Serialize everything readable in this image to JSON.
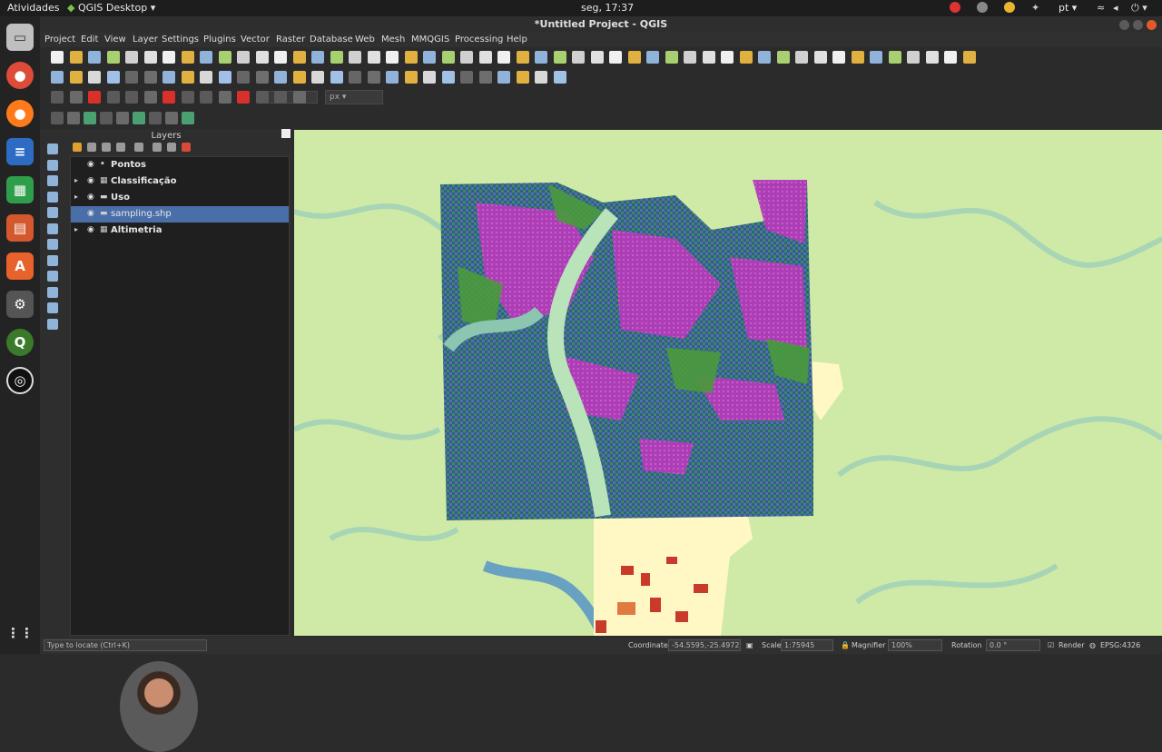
{
  "topbar": {
    "activities": "Atividades",
    "app_menu": "QGIS Desktop",
    "clock": "seg, 17:37",
    "lang": "pt"
  },
  "window": {
    "title": "*Untitled Project - QGIS"
  },
  "menu": [
    "Project",
    "Edit",
    "View",
    "Layer",
    "Settings",
    "Plugins",
    "Vector",
    "Raster",
    "Database",
    "Web",
    "Mesh",
    "MMQGIS",
    "Processing",
    "Help"
  ],
  "toolbar": {
    "unit_label": "px"
  },
  "layers_panel": {
    "title": "Layers"
  },
  "layers": [
    {
      "name": "Pontos",
      "type": "point",
      "expanded": false,
      "visible": true,
      "selected": false
    },
    {
      "name": "Classificação",
      "type": "raster",
      "expanded": true,
      "visible": true,
      "selected": false
    },
    {
      "name": "Uso",
      "type": "vector",
      "expanded": true,
      "visible": true,
      "selected": false
    },
    {
      "name": "sampling.shp",
      "type": "vector",
      "expanded": false,
      "visible": true,
      "selected": true
    },
    {
      "name": "Altimetria",
      "type": "raster",
      "expanded": true,
      "visible": true,
      "selected": false
    }
  ],
  "statusbar": {
    "locator_placeholder": "Type to locate (Ctrl+K)",
    "coordinate_label": "Coordinate",
    "coordinate_value": "-54.5595,-25.4972",
    "scale_label": "Scale",
    "scale_value": "1:75945",
    "magnifier_label": "Magnifier",
    "magnifier_value": "100%",
    "rotation_label": "Rotation",
    "rotation_value": "0.0 °",
    "render_label": "Render",
    "crs_label": "EPSG:4326"
  },
  "colors": {
    "accent_selected": "#4a6ea8",
    "map_bg": "#cfeaa6",
    "class_purple": "#b23cb8",
    "class_green": "#4a9a3c",
    "class_blue": "#2d5e8e"
  }
}
